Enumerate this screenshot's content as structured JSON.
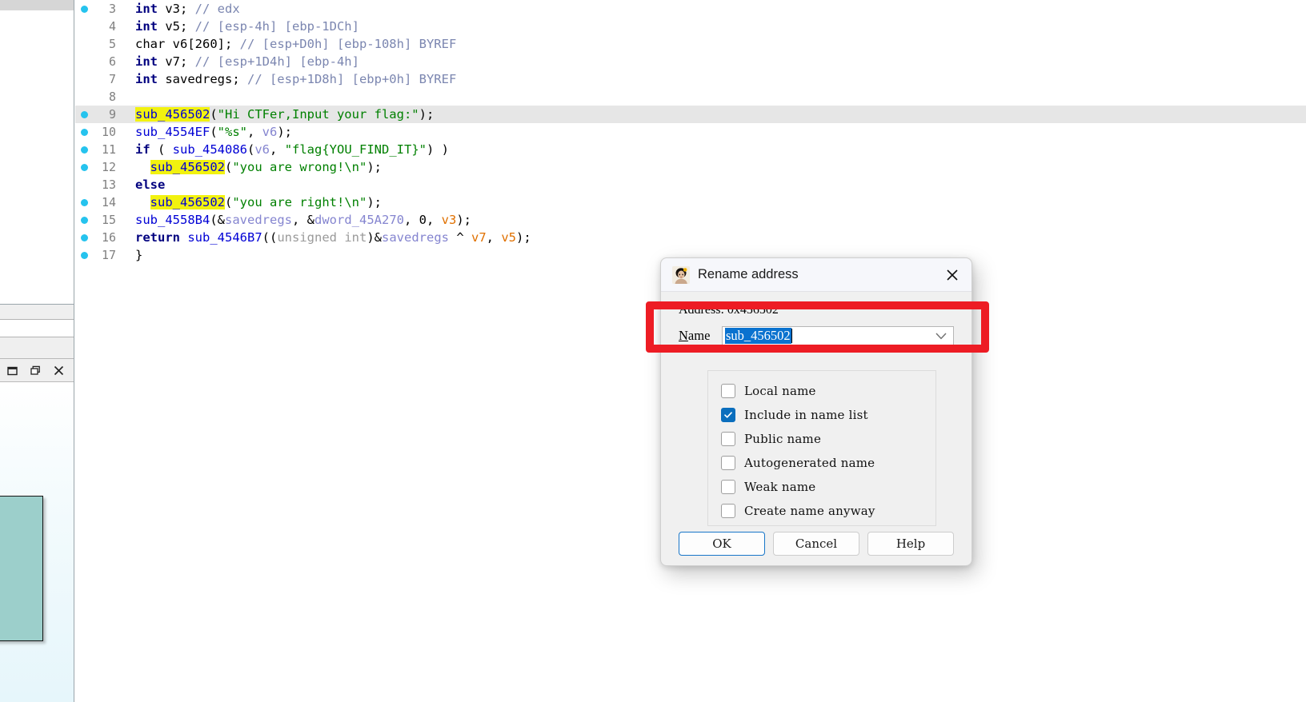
{
  "app": {
    "window_title": "Rename address"
  },
  "code_view": {
    "lines": [
      {
        "num": "3",
        "breakpoint": true,
        "current": false,
        "tokens": [
          {
            "t": "kw",
            "v": "int"
          },
          {
            "t": "pln",
            "v": " v3; "
          },
          {
            "t": "cmt",
            "v": "// edx"
          }
        ],
        "text": "int v3; // edx"
      },
      {
        "num": "4",
        "breakpoint": false,
        "current": false,
        "tokens": [
          {
            "t": "kw",
            "v": "int"
          },
          {
            "t": "pln",
            "v": " v5; "
          },
          {
            "t": "cmt",
            "v": "// [esp-4h] [ebp-1DCh]"
          }
        ],
        "text": "int v5; // [esp-4h] [ebp-1DCh]"
      },
      {
        "num": "5",
        "breakpoint": false,
        "current": false,
        "tokens": [
          {
            "t": "pln",
            "v": "char v6[260]; "
          },
          {
            "t": "cmt",
            "v": "// [esp+D0h] [ebp-108h] BYREF"
          }
        ],
        "text": "char v6[260]; // [esp+D0h] [ebp-108h] BYREF"
      },
      {
        "num": "6",
        "breakpoint": false,
        "current": false,
        "tokens": [
          {
            "t": "kw",
            "v": "int"
          },
          {
            "t": "pln",
            "v": " v7; "
          },
          {
            "t": "cmt",
            "v": "// [esp+1D4h] [ebp-4h]"
          }
        ],
        "text": "int v7; // [esp+1D4h] [ebp-4h]"
      },
      {
        "num": "7",
        "breakpoint": false,
        "current": false,
        "tokens": [
          {
            "t": "kw",
            "v": "int"
          },
          {
            "t": "pln",
            "v": " savedregs; "
          },
          {
            "t": "cmt",
            "v": "// [esp+1D8h] [ebp+0h] BYREF"
          }
        ],
        "text": "int savedregs; // [esp+1D8h] [ebp+0h] BYREF"
      },
      {
        "num": "8",
        "breakpoint": false,
        "current": false,
        "tokens": [],
        "text": ""
      },
      {
        "num": "9",
        "breakpoint": true,
        "current": true,
        "tokens": [
          {
            "t": "fnhi",
            "v": "sub_456502"
          },
          {
            "t": "brk",
            "v": "("
          },
          {
            "t": "str",
            "v": "\"Hi CTFer,Input your flag:\""
          },
          {
            "t": "brk",
            "v": ");"
          }
        ],
        "text": "sub_456502(\"Hi CTFer,Input your flag:\");"
      },
      {
        "num": "10",
        "breakpoint": true,
        "current": false,
        "tokens": [
          {
            "t": "fn",
            "v": "sub_4554EF"
          },
          {
            "t": "brk",
            "v": "("
          },
          {
            "t": "str",
            "v": "\"%s\""
          },
          {
            "t": "brk",
            "v": ", "
          },
          {
            "t": "var",
            "v": "v6"
          },
          {
            "t": "brk",
            "v": ");"
          }
        ],
        "text": "sub_4554EF(\"%s\", v6);"
      },
      {
        "num": "11",
        "breakpoint": true,
        "current": false,
        "tokens": [
          {
            "t": "kw",
            "v": "if"
          },
          {
            "t": "brk",
            "v": " ( "
          },
          {
            "t": "fn",
            "v": "sub_454086"
          },
          {
            "t": "brk",
            "v": "("
          },
          {
            "t": "var",
            "v": "v6"
          },
          {
            "t": "brk",
            "v": ", "
          },
          {
            "t": "str",
            "v": "\"flag{YOU_FIND_IT}\""
          },
          {
            "t": "brk",
            "v": ") )"
          }
        ],
        "text": "if ( sub_454086(v6, \"flag{YOU_FIND_IT}\") )"
      },
      {
        "num": "12",
        "breakpoint": true,
        "current": false,
        "tokens": [
          {
            "t": "pln",
            "v": "  "
          },
          {
            "t": "fnhi",
            "v": "sub_456502"
          },
          {
            "t": "brk",
            "v": "("
          },
          {
            "t": "str",
            "v": "\"you are wrong!\\n\""
          },
          {
            "t": "brk",
            "v": ");"
          }
        ],
        "text": "  sub_456502(\"you are wrong!\\n\");"
      },
      {
        "num": "13",
        "breakpoint": false,
        "current": false,
        "tokens": [
          {
            "t": "kw",
            "v": "else"
          }
        ],
        "text": "else"
      },
      {
        "num": "14",
        "breakpoint": true,
        "current": false,
        "tokens": [
          {
            "t": "pln",
            "v": "  "
          },
          {
            "t": "fnhi",
            "v": "sub_456502"
          },
          {
            "t": "brk",
            "v": "("
          },
          {
            "t": "str",
            "v": "\"you are right!\\n\""
          },
          {
            "t": "brk",
            "v": ");"
          }
        ],
        "text": "  sub_456502(\"you are right!\\n\");"
      },
      {
        "num": "15",
        "breakpoint": true,
        "current": false,
        "tokens": [
          {
            "t": "fn",
            "v": "sub_4558B4"
          },
          {
            "t": "brk",
            "v": "(&"
          },
          {
            "t": "var",
            "v": "savedregs"
          },
          {
            "t": "brk",
            "v": ", &"
          },
          {
            "t": "var",
            "v": "dword_45A270"
          },
          {
            "t": "brk",
            "v": ", 0, "
          },
          {
            "t": "varo",
            "v": "v3"
          },
          {
            "t": "brk",
            "v": ");"
          }
        ],
        "text": "sub_4558B4(&savedregs, &dword_45A270, 0, v3);"
      },
      {
        "num": "16",
        "breakpoint": true,
        "current": false,
        "tokens": [
          {
            "t": "kw",
            "v": "return"
          },
          {
            "t": "pln",
            "v": " "
          },
          {
            "t": "fn",
            "v": "sub_4546B7"
          },
          {
            "t": "brk",
            "v": "(("
          },
          {
            "t": "dim",
            "v": "unsigned int"
          },
          {
            "t": "brk",
            "v": ")&"
          },
          {
            "t": "var",
            "v": "savedregs"
          },
          {
            "t": "brk",
            "v": " ^ "
          },
          {
            "t": "varo",
            "v": "v7"
          },
          {
            "t": "brk",
            "v": ", "
          },
          {
            "t": "varo",
            "v": "v5"
          },
          {
            "t": "brk",
            "v": ");"
          }
        ],
        "text": "return sub_4546B7((unsigned int)&savedregs ^ v7, v5);"
      },
      {
        "num": "17",
        "breakpoint": true,
        "current": false,
        "tokens": [
          {
            "t": "brk",
            "v": "}"
          }
        ],
        "text": "}"
      }
    ]
  },
  "dialog": {
    "title": "Rename address",
    "close_label": "✕",
    "address_text": "Address: 0x456502",
    "name_label_prefix": "N",
    "name_label_rest": "ame",
    "name_value": "sub_456502",
    "options": [
      {
        "label": "Local name",
        "checked": false
      },
      {
        "label": "Include in name list",
        "checked": true
      },
      {
        "label": "Public name",
        "checked": false
      },
      {
        "label": "Autogenerated name",
        "checked": false
      },
      {
        "label": "Weak name",
        "checked": false
      },
      {
        "label": "Create name anyway",
        "checked": false
      }
    ],
    "buttons": {
      "ok": "OK",
      "cancel": "Cancel",
      "help": "Help"
    }
  },
  "annotation": {
    "color": "#ed1c24"
  },
  "colors": {
    "current_line": "#e6e6e6",
    "highlight_name": "#f2f20f",
    "breakpoint_dot": "#25c3ee",
    "string": "#008000",
    "function": "#0000d5",
    "keyword": "#00007f",
    "comment": "#7b86b0",
    "selection": "#0a72cf",
    "graph_node": "#9ccfcb"
  }
}
